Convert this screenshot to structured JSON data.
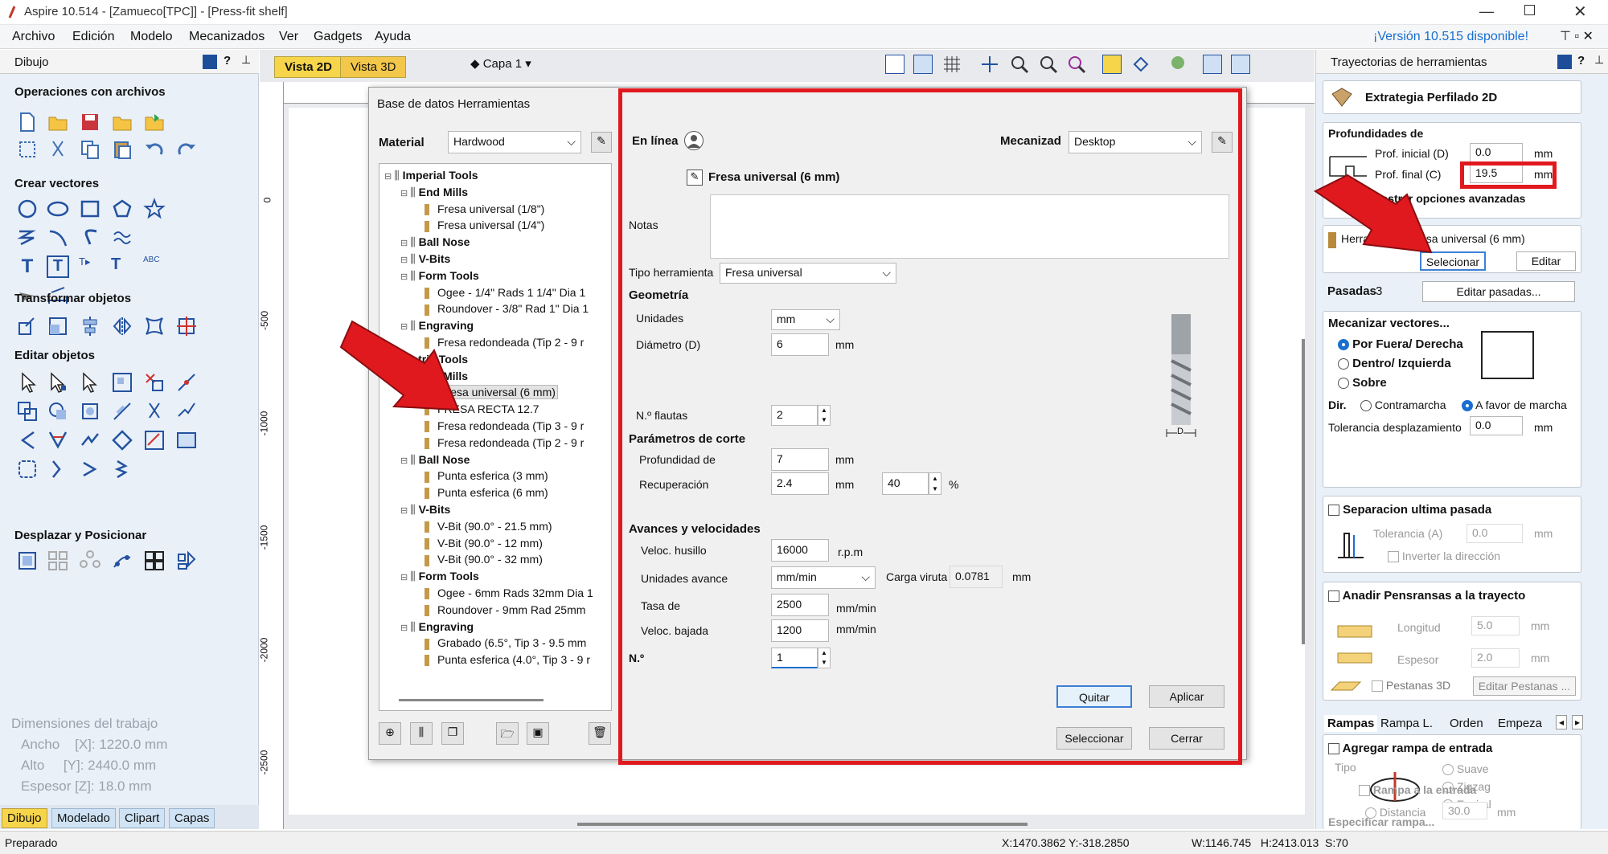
{
  "window": {
    "title": "Aspire 10.514 - [Zamueco[TPC]] - [Press-fit shelf]"
  },
  "menu": {
    "items": [
      "Archivo",
      "Edición",
      "Modelo",
      "Mecanizados",
      "Ver",
      "Gadgets",
      "Ayuda"
    ],
    "update_notice": "¡Versión 10.515 disponible!"
  },
  "left_panel": {
    "title": "Dibujo",
    "sections": {
      "files": "Operaciones con archivos",
      "vectors": "Crear vectores",
      "transform": "Transformar objetos",
      "edit": "Editar objetos",
      "move": "Desplazar y Posicionar"
    },
    "job": {
      "title": "Dimensiones del trabajo",
      "width": "Ancho    [X]: 1220.0 mm",
      "height": "Alto     [Y]: 2440.0 mm",
      "thickness": "Espesor [Z]: 18.0 mm"
    },
    "tabs": [
      "Dibujo",
      "Modelado",
      "Clipart",
      "Capas"
    ]
  },
  "view": {
    "tab2d": "Vista 2D",
    "tab3d": "Vista 3D",
    "layer": "Capa 1",
    "ruler_v": [
      "0",
      "-500",
      "-1000",
      "-1500",
      "-2000",
      "-2500"
    ]
  },
  "dialog": {
    "title": "Base de datos Herramientas",
    "material_label": "Material",
    "material_value": "Hardwood",
    "tree": [
      {
        "depth": 0,
        "text": "Imperial Tools",
        "bold": true
      },
      {
        "depth": 1,
        "text": "End Mills",
        "bold": true
      },
      {
        "depth": 2,
        "text": "Fresa universal (1/8\")"
      },
      {
        "depth": 2,
        "text": "Fresa universal (1/4\")"
      },
      {
        "depth": 1,
        "text": "Ball Nose",
        "bold": true
      },
      {
        "depth": 1,
        "text": "V-Bits",
        "bold": true
      },
      {
        "depth": 1,
        "text": "Form Tools",
        "bold": true
      },
      {
        "depth": 2,
        "text": "Ogee - 1/4\" Rads 1 1/4\" Dia 1"
      },
      {
        "depth": 2,
        "text": "Roundover - 3/8\" Rad 1\" Dia 1"
      },
      {
        "depth": 1,
        "text": "Engraving",
        "bold": true
      },
      {
        "depth": 2,
        "text": "Fresa redondeada (Tip 2 - 9 r"
      },
      {
        "depth": 0,
        "text": "Metric Tools",
        "bold": true
      },
      {
        "depth": 1,
        "text": "End Mills",
        "bold": true
      },
      {
        "depth": 2,
        "text": "Fresa universal (6 mm)",
        "selected": true
      },
      {
        "depth": 2,
        "text": "FRESA RECTA 12.7"
      },
      {
        "depth": 2,
        "text": "Fresa redondeada (Tip 3 - 9 r"
      },
      {
        "depth": 2,
        "text": "Fresa redondeada (Tip 2 - 9 r"
      },
      {
        "depth": 1,
        "text": "Ball Nose",
        "bold": true
      },
      {
        "depth": 2,
        "text": "Punta esferica (3 mm)"
      },
      {
        "depth": 2,
        "text": "Punta esferica (6 mm)"
      },
      {
        "depth": 1,
        "text": "V-Bits",
        "bold": true
      },
      {
        "depth": 2,
        "text": "V-Bit (90.0° - 21.5 mm)"
      },
      {
        "depth": 2,
        "text": "V-Bit (90.0° - 12 mm)"
      },
      {
        "depth": 2,
        "text": "V-Bit (90.0° - 32 mm)"
      },
      {
        "depth": 1,
        "text": "Form Tools",
        "bold": true
      },
      {
        "depth": 2,
        "text": "Ogee - 6mm Rads 32mm Dia 1"
      },
      {
        "depth": 2,
        "text": "Roundover -  9mm Rad 25mm"
      },
      {
        "depth": 1,
        "text": "Engraving",
        "bold": true
      },
      {
        "depth": 2,
        "text": "Grabado (6.5°, Tip 3 - 9.5 mm"
      },
      {
        "depth": 2,
        "text": "Punta esferica (4.0°, Tip 3 - 9 r"
      }
    ],
    "online_label": "En línea",
    "machine_label": "Mecanizad",
    "machine_value": "Desktop",
    "tool_name": "Fresa universal (6 mm)",
    "notes_label": "Notas",
    "tool_type_label": "Tipo herramienta",
    "tool_type_value": "Fresa universal",
    "geometry": "Geometría",
    "units_label": "Unidades",
    "units_value": "mm",
    "diameter_label": "Diámetro (D)",
    "diameter_value": "6",
    "mm": "mm",
    "flutes_label": "N.º flautas",
    "flutes_value": "2",
    "cut_params": "Parámetros de corte",
    "depth_label": "Profundidad de",
    "depth_value": "7",
    "stepover_label": "Recuperación",
    "stepover_value": "2.4",
    "stepover_pct": "40",
    "pct": "%",
    "feeds": "Avances y velocidades",
    "spindle_label": "Veloc. husillo",
    "spindle_value": "16000",
    "rpm": "r.p.m",
    "feed_units_label": "Unidades avance",
    "feed_units_value": "mm/min",
    "chip_label": "Carga viruta",
    "chip_value": "0.0781",
    "feed_label": "Tasa de",
    "feed_value": "2500",
    "plunge_label": "Veloc. bajada",
    "plunge_value": "1200",
    "mm_min": "mm/min",
    "number_label": "N.º",
    "number_value": "1",
    "btn_remove": "Quitar",
    "btn_apply": "Aplicar",
    "btn_select": "Seleccionar",
    "btn_close": "Cerrar",
    "diagram_d": "D"
  },
  "right_panel": {
    "title": "Trayectorias de herramientas",
    "strategy": "Extrategia Perfilado 2D",
    "depths_title": "Profundidades de",
    "start_label": "Prof. inicial (D)",
    "start_value": "0.0",
    "end_label": "Prof. final (C)",
    "end_value": "19.5",
    "mm": "mm",
    "advanced": "Mostrar opciones avanzadas",
    "tool_label": "Herramienta: Fresa universal (6 mm)",
    "btn_select": "Selecionar",
    "btn_edit": "Editar",
    "passes_label": "Pasadas",
    "passes_value": "3",
    "btn_edit_passes": "Editar pasadas...",
    "machine_vectors": "Mecanizar vectores...",
    "opt_outside": "Por Fuera/ Derecha",
    "opt_inside": "Dentro/ Izquierda",
    "opt_on": "Sobre",
    "dir_label": "Dir.",
    "dir_conv": "Contramarcha",
    "dir_climb": "A favor de marcha",
    "offset_label": "Tolerancia desplazamiento",
    "offset_value": "0.0",
    "last_pass": "Separacion ultima pasada",
    "allowance_label": "Tolerancia (A)",
    "allowance_value": "0.0",
    "reverse": "Inverter la dirección",
    "tabs_title": "Anadir Pensransas a la trayecto",
    "length_label": "Longitud",
    "length_value": "5.0",
    "thick_label": "Espesor",
    "thick_value": "2.0",
    "tabs3d": "Pestanas 3D",
    "edit_tabs": "Editar Pestanas ...",
    "bottom_tabs": [
      "Rampas",
      "Rampa L.",
      "Orden",
      "Empeza"
    ],
    "ramp_add": "Agregar rampa de entrada",
    "type_label": "Tipo",
    "ramp_smooth": "Suave",
    "ramp_zigzag": "Zigzag",
    "ramp_spiral": "Espiral",
    "ramp_specify": "Especificar rampa...",
    "ramp_entry": "Rampa a la entrada",
    "distance_label": "Distancia",
    "distance_value": "30.0"
  },
  "status": {
    "left": "Preparado",
    "coords": "X:1470.3862 Y:-318.2850",
    "size": "W:1146.745   H:2413.013  S:70"
  },
  "colors": {
    "highlight_red": "#e0191e",
    "panel_bg": "#e9f0f8",
    "tab_yellow": "#f7d54a"
  }
}
